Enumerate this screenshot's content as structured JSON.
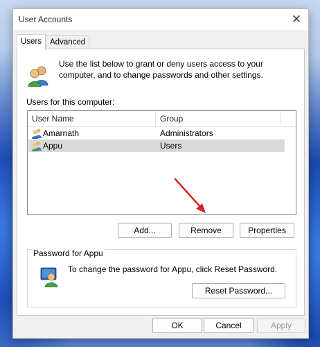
{
  "window": {
    "title": "User Accounts"
  },
  "tabs": [
    {
      "label": "Users",
      "active": true
    },
    {
      "label": "Advanced",
      "active": false
    }
  ],
  "intro": {
    "text": "Use the list below to grant or deny users access to your computer, and to change passwords and other settings."
  },
  "users_section": {
    "label": "Users for this computer:",
    "columns": [
      "User Name",
      "Group"
    ],
    "rows": [
      {
        "name": "Amarnath",
        "group": "Administrators",
        "selected": false
      },
      {
        "name": "Appu",
        "group": "Users",
        "selected": true
      }
    ]
  },
  "user_buttons": {
    "add": "Add...",
    "remove": "Remove",
    "properties": "Properties"
  },
  "password_group": {
    "title": "Password for Appu",
    "text": "To change the password for Appu, click Reset Password.",
    "reset_button": "Reset Password..."
  },
  "footer": {
    "ok": "OK",
    "cancel": "Cancel",
    "apply": "Apply"
  },
  "annotation": {
    "arrow_color": "#e02020"
  },
  "colors": {
    "selection": "#d9d9d9",
    "window_bg": "#f0f0f0"
  }
}
